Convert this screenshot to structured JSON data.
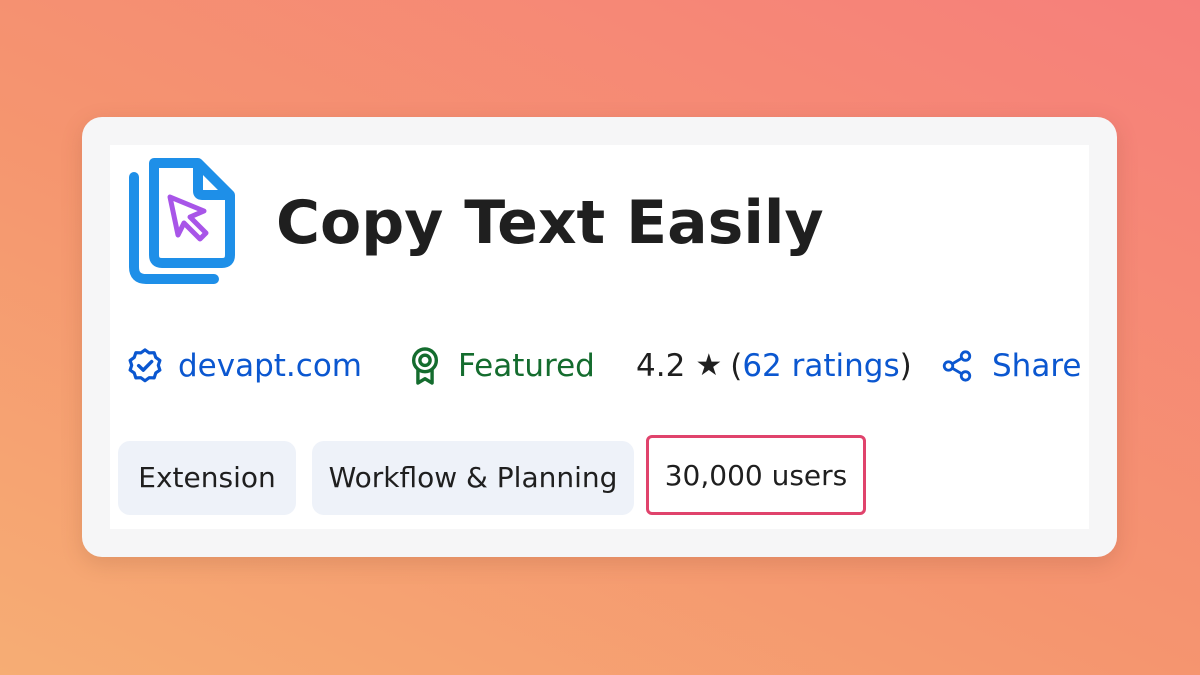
{
  "extension": {
    "title": "Copy Text Easily",
    "icon": "copy-document-cursor-icon",
    "publisher": "devapt.com",
    "publisher_icon": "verified-badge-icon",
    "featured_label": "Featured",
    "featured_icon": "award-ribbon-icon",
    "rating": "4.2",
    "rating_open": "(",
    "ratings_count_label": "62 ratings",
    "rating_close": ")",
    "share_label": "Share",
    "share_icon": "share-icon"
  },
  "chips": {
    "type": "Extension",
    "category": "Workflow & Planning",
    "users": "30,000 users"
  },
  "colors": {
    "link": "#0b57d0",
    "featured": "#146c2e",
    "title": "#1f1f1f",
    "chip_bg": "#eef2f9",
    "highlight_border": "#e0436c",
    "logo_blue": "#1e8fe8",
    "cursor_purple": "#a855e8"
  }
}
